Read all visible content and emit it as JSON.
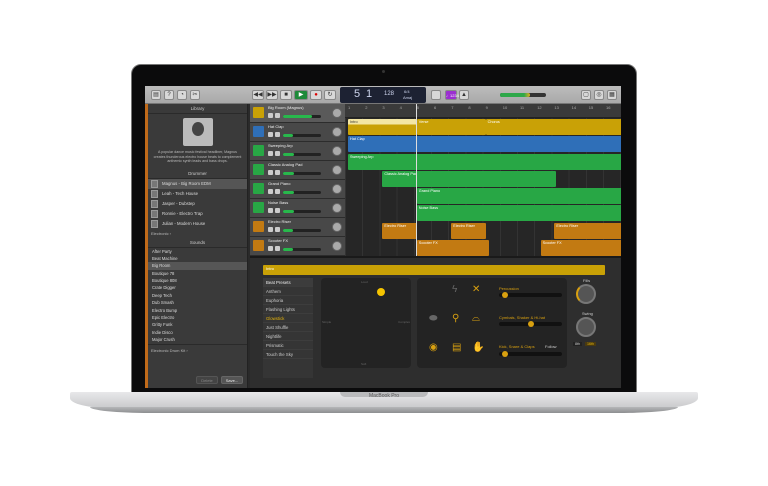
{
  "device": {
    "brand": "MacBook Pro"
  },
  "toolbar": {
    "bar": "5",
    "beat": "1",
    "tempo": "128",
    "key_top": "6/4",
    "key_bottom": "Amaj",
    "count_in": "♩1234",
    "master_volume_pct": 65
  },
  "library": {
    "title": "Library",
    "description": "A popular dance music festival headliner, Magnus creates thunderous electro house beats to complement anthemic synth leads and bass drops.",
    "drummer_header": "Drummer",
    "drummers": [
      "Magnus - Big Room EDM",
      "Leah - Tech House",
      "Jasper - Dubstep",
      "Ronnie - Electro Trap",
      "Julian - Modern House"
    ],
    "genre": "Electronic",
    "sounds_header": "Sounds",
    "sounds": [
      "After Party",
      "Beat Machine",
      "Big Room",
      "Boutique 78",
      "Boutique 808",
      "Crate Digger",
      "Deep Tech",
      "Dub Smash",
      "Electro Bump",
      "Epic Electro",
      "Gritty Funk",
      "Indie Disco",
      "Major Crush"
    ],
    "selected_sound": "Big Room",
    "kit": "Electronic Drum Kit",
    "delete_label": "Delete",
    "save_label": "Save..."
  },
  "tracks": [
    {
      "name": "Big Room (Magnus)",
      "volume": 0.75,
      "color": "#c9a106"
    },
    {
      "name": "Hat Clap",
      "volume": 0.25,
      "color": "#2f6fb8"
    },
    {
      "name": "Sweeping Arp",
      "volume": 0.3,
      "color": "#28a745"
    },
    {
      "name": "Classic Analog Pad",
      "volume": 0.28,
      "color": "#28a745"
    },
    {
      "name": "Grand Piano",
      "volume": 0.3,
      "color": "#28a745"
    },
    {
      "name": "Noise Bass",
      "volume": 0.3,
      "color": "#28a745"
    },
    {
      "name": "Electro Riser",
      "volume": 0.27,
      "color": "#c27a12"
    },
    {
      "name": "Scooter FX",
      "volume": 0.27,
      "color": "#c27a12"
    }
  ],
  "ruler": [
    "1",
    "2",
    "3",
    "4",
    "5",
    "6",
    "7",
    "8",
    "9",
    "10",
    "11",
    "12",
    "13",
    "14",
    "15",
    "16"
  ],
  "regions": [
    {
      "track": 0,
      "label": "Intro",
      "start": 1,
      "end": 5
    },
    {
      "track": 0,
      "label": "Verse",
      "start": 5,
      "end": 9
    },
    {
      "track": 0,
      "label": "Chorus",
      "start": 9,
      "end": 17
    },
    {
      "track": 1,
      "label": "Hat Clap",
      "start": 1,
      "end": 17
    },
    {
      "track": 2,
      "label": "Sweeping Arp",
      "start": 1,
      "end": 17
    },
    {
      "track": 3,
      "label": "Classic Analog Pad",
      "start": 3,
      "end": 13.1
    },
    {
      "track": 4,
      "label": "Grand Piano",
      "start": 5,
      "end": 17
    },
    {
      "track": 5,
      "label": "Noise Bass",
      "start": 5,
      "end": 17
    },
    {
      "track": 6,
      "label": "Electro Riser",
      "start": 3,
      "end": 5
    },
    {
      "track": 6,
      "label": "Electro Riser",
      "start": 7,
      "end": 9
    },
    {
      "track": 6,
      "label": "Electro Riser",
      "start": 13,
      "end": 17
    },
    {
      "track": 7,
      "label": "Scooter FX",
      "start": 5,
      "end": 9.2
    },
    {
      "track": 7,
      "label": "Scooter FX",
      "start": 12.2,
      "end": 17
    }
  ],
  "editor": {
    "region_label": "Intro",
    "presets_header": "Beat Presets",
    "presets": [
      "Anthem",
      "Euphoria",
      "Flashing Lights",
      "Glowstick",
      "Just Shuffle",
      "Nightlife",
      "Prismatic",
      "Touch the Sky"
    ],
    "selected_preset": "Glowstick",
    "pad_top": "Loud",
    "pad_bottom": "Soft",
    "pad_left": "Simple",
    "pad_right": "Complex",
    "percussion_label": "Percussion",
    "percussion": 0.05,
    "cymbals_label": "Cymbals, Shaker & Hi-hat",
    "cymbals": 0.5,
    "kick_label": "Kick, Snare & Claps",
    "kick": 0.05,
    "follow_label": "Follow",
    "fills_label": "Fills",
    "swing_label": "Swing",
    "swing_8": "8th",
    "swing_16": "16th"
  }
}
